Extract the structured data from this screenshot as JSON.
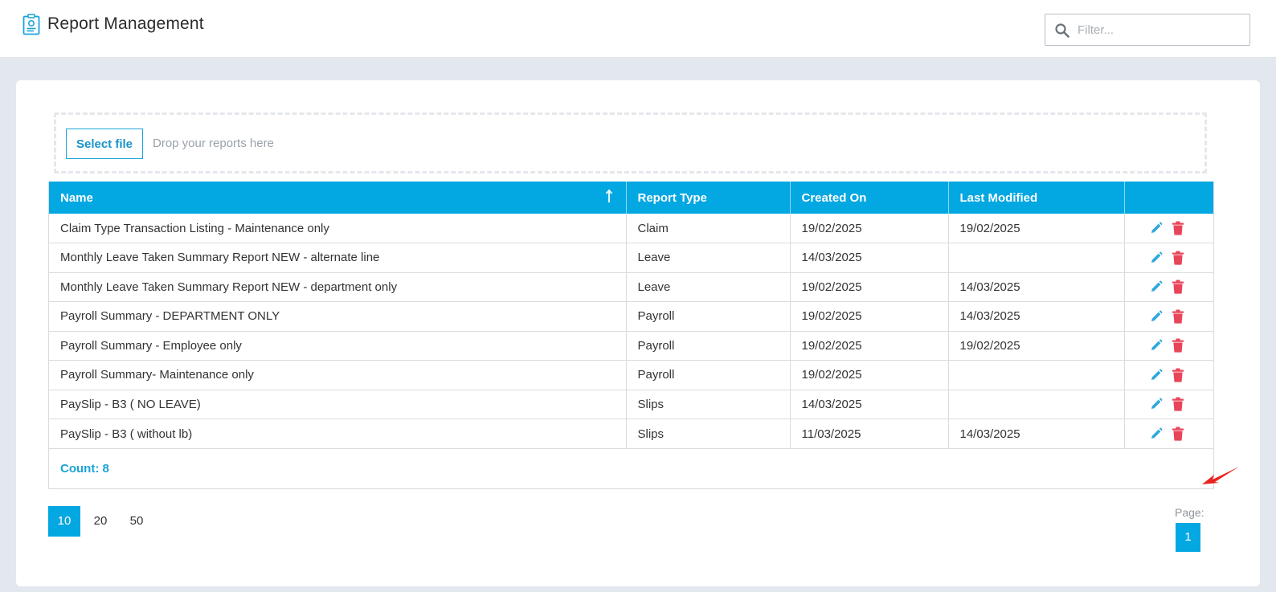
{
  "header": {
    "title": "Report Management",
    "filter_placeholder": "Filter..."
  },
  "upload": {
    "button_label": "Select file",
    "drop_text": "Drop your reports here"
  },
  "table": {
    "columns": [
      "Name",
      "Report Type",
      "Created On",
      "Last Modified",
      ""
    ],
    "sort_column": "Name",
    "sort_direction": "ascending",
    "rows": [
      {
        "name": "Claim Type Transaction Listing - Maintenance only",
        "type": "Claim",
        "created": "19/02/2025",
        "modified": "19/02/2025"
      },
      {
        "name": "Monthly Leave Taken Summary Report NEW - alternate line",
        "type": "Leave",
        "created": "14/03/2025",
        "modified": ""
      },
      {
        "name": "Monthly Leave Taken Summary Report NEW - department only",
        "type": "Leave",
        "created": "19/02/2025",
        "modified": "14/03/2025"
      },
      {
        "name": "Payroll Summary - DEPARTMENT ONLY",
        "type": "Payroll",
        "created": "19/02/2025",
        "modified": "14/03/2025"
      },
      {
        "name": "Payroll Summary - Employee only",
        "type": "Payroll",
        "created": "19/02/2025",
        "modified": "19/02/2025"
      },
      {
        "name": "Payroll Summary- Maintenance only",
        "type": "Payroll",
        "created": "19/02/2025",
        "modified": ""
      },
      {
        "name": "PaySlip - B3 ( NO LEAVE)",
        "type": "Slips",
        "created": "14/03/2025",
        "modified": ""
      },
      {
        "name": "PaySlip - B3 ( without lb)",
        "type": "Slips",
        "created": "11/03/2025",
        "modified": "14/03/2025"
      }
    ],
    "count_label": "Count: 8"
  },
  "pagination": {
    "page_sizes": [
      "10",
      "20",
      "50"
    ],
    "active_page_size": "10",
    "page_label": "Page:",
    "current_page": "1"
  },
  "colors": {
    "accent": "#03a7e2",
    "edit_icon": "#2fa8dc",
    "delete_icon": "#e8455a",
    "annotation_arrow": "#e8231f"
  },
  "icons": {
    "header": "report-clipboard-icon",
    "filter": "search-icon",
    "sort": "sort-arrow-up-icon",
    "edit": "pencil-icon",
    "delete": "trash-icon",
    "annotation": "red-arrow-icon"
  }
}
